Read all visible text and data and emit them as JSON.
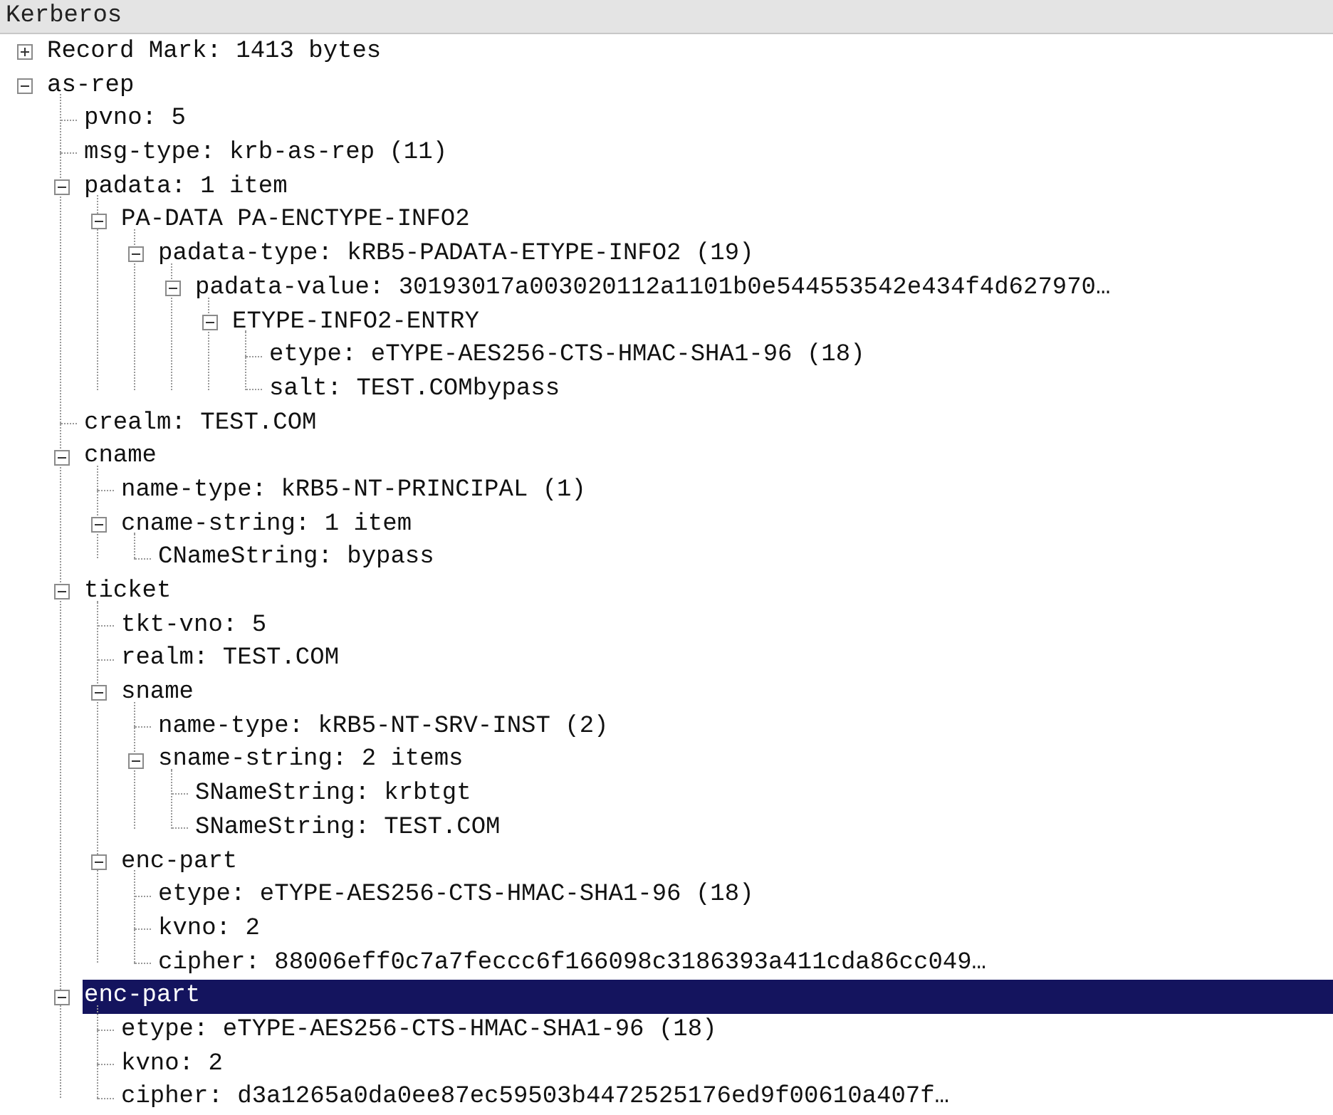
{
  "header": {
    "title": "Kerberos"
  },
  "tree": [
    {
      "label": "Record Mark: 1413 bytes",
      "expanded": false,
      "selected": false
    },
    {
      "label": "as-rep",
      "expanded": true,
      "selected": false,
      "children": [
        {
          "label": "pvno: 5",
          "selected": false
        },
        {
          "label": "msg-type: krb-as-rep (11)",
          "selected": false
        },
        {
          "label": "padata: 1 item",
          "expanded": true,
          "selected": false,
          "children": [
            {
              "label": "PA-DATA PA-ENCTYPE-INFO2",
              "expanded": true,
              "selected": false,
              "children": [
                {
                  "label": "padata-type: kRB5-PADATA-ETYPE-INFO2 (19)",
                  "expanded": true,
                  "selected": false,
                  "children": [
                    {
                      "label": "padata-value: 30193017a003020112a1101b0e544553542e434f4d627970…",
                      "expanded": true,
                      "selected": false,
                      "children": [
                        {
                          "label": "ETYPE-INFO2-ENTRY",
                          "expanded": true,
                          "selected": false,
                          "children": [
                            {
                              "label": "etype: eTYPE-AES256-CTS-HMAC-SHA1-96 (18)",
                              "selected": false
                            },
                            {
                              "label": "salt: TEST.COMbypass",
                              "selected": false
                            }
                          ]
                        }
                      ]
                    }
                  ]
                }
              ]
            }
          ]
        },
        {
          "label": "crealm: TEST.COM",
          "selected": false
        },
        {
          "label": "cname",
          "expanded": true,
          "selected": false,
          "children": [
            {
              "label": "name-type: kRB5-NT-PRINCIPAL (1)",
              "selected": false
            },
            {
              "label": "cname-string: 1 item",
              "expanded": true,
              "selected": false,
              "children": [
                {
                  "label": "CNameString: bypass",
                  "selected": false
                }
              ]
            }
          ]
        },
        {
          "label": "ticket",
          "expanded": true,
          "selected": false,
          "children": [
            {
              "label": "tkt-vno: 5",
              "selected": false
            },
            {
              "label": "realm: TEST.COM",
              "selected": false
            },
            {
              "label": "sname",
              "expanded": true,
              "selected": false,
              "children": [
                {
                  "label": "name-type: kRB5-NT-SRV-INST (2)",
                  "selected": false
                },
                {
                  "label": "sname-string: 2 items",
                  "expanded": true,
                  "selected": false,
                  "children": [
                    {
                      "label": "SNameString: krbtgt",
                      "selected": false
                    },
                    {
                      "label": "SNameString: TEST.COM",
                      "selected": false
                    }
                  ]
                }
              ]
            },
            {
              "label": "enc-part",
              "expanded": true,
              "selected": false,
              "children": [
                {
                  "label": "etype: eTYPE-AES256-CTS-HMAC-SHA1-96 (18)",
                  "selected": false
                },
                {
                  "label": "kvno: 2",
                  "selected": false
                },
                {
                  "label": "cipher: 88006eff0c7a7feccc6f166098c3186393a411cda86cc049…",
                  "selected": false
                }
              ]
            }
          ]
        },
        {
          "label": "enc-part",
          "expanded": true,
          "selected": true,
          "children": [
            {
              "label": "etype: eTYPE-AES256-CTS-HMAC-SHA1-96 (18)",
              "selected": false
            },
            {
              "label": "kvno: 2",
              "selected": false
            },
            {
              "label": "cipher: d3a1265a0da0ee87ec59503b4472525176ed9f00610a407f…",
              "selected": false
            }
          ]
        }
      ]
    }
  ]
}
